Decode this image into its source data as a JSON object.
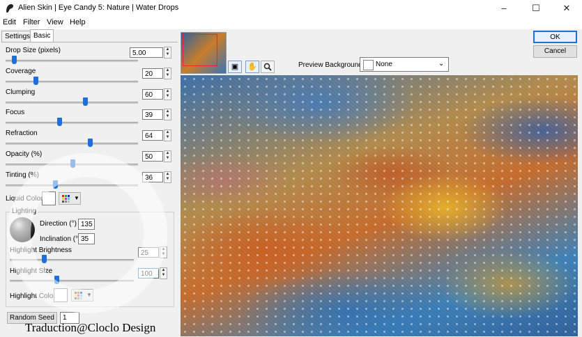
{
  "window": {
    "title": "Alien Skin | Eye Candy 5: Nature | Water Drops",
    "minimize": "–",
    "maximize": "☐",
    "close": "✕"
  },
  "menu": [
    "Edit",
    "Filter",
    "View",
    "Help"
  ],
  "tabs": [
    {
      "label": "Settings",
      "active": false
    },
    {
      "label": "Basic",
      "active": true
    }
  ],
  "sliders": [
    {
      "label": "Drop Size (pixels)",
      "value": "5.00",
      "fraction": 0.02
    },
    {
      "label": "Coverage",
      "value": "20",
      "fraction": 0.2
    },
    {
      "label": "Clumping",
      "value": "60",
      "fraction": 0.6
    },
    {
      "label": "Focus",
      "value": "39",
      "fraction": 0.39
    },
    {
      "label": "Refraction",
      "value": "64",
      "fraction": 0.64
    },
    {
      "label": "Opacity (%)",
      "value": "50",
      "fraction": 0.5
    },
    {
      "label": "Tinting (%)",
      "value": "36",
      "fraction": 0.36
    }
  ],
  "liquid_color": {
    "label": "Liquid Color",
    "color": "#ffffff"
  },
  "lighting": {
    "group_label": "Lighting",
    "direction_label": "Direction (°)",
    "direction_value": "135",
    "inclination_label": "Inclination (°)",
    "inclination_value": "35",
    "highlight_brightness_label": "Highlight Brightness",
    "highlight_brightness_value": "25",
    "highlight_brightness_fraction": 0.25,
    "highlight_size_label": "Highlight Size",
    "highlight_size_value": "100",
    "highlight_size_fraction": 0.36,
    "highlight_color_label": "Highlight Color",
    "highlight_color": "#ffffff"
  },
  "random_seed": {
    "label": "Random Seed",
    "value": "1"
  },
  "buttons": {
    "ok": "OK",
    "cancel": "Cancel"
  },
  "preview_background": {
    "label": "Preview Background:",
    "value": "None"
  },
  "toolbar_icons": [
    "preview-select-icon",
    "hand-icon",
    "zoom-icon"
  ],
  "credit": "Traduction@Cloclo Design",
  "accent_color": "#1e6fd9"
}
